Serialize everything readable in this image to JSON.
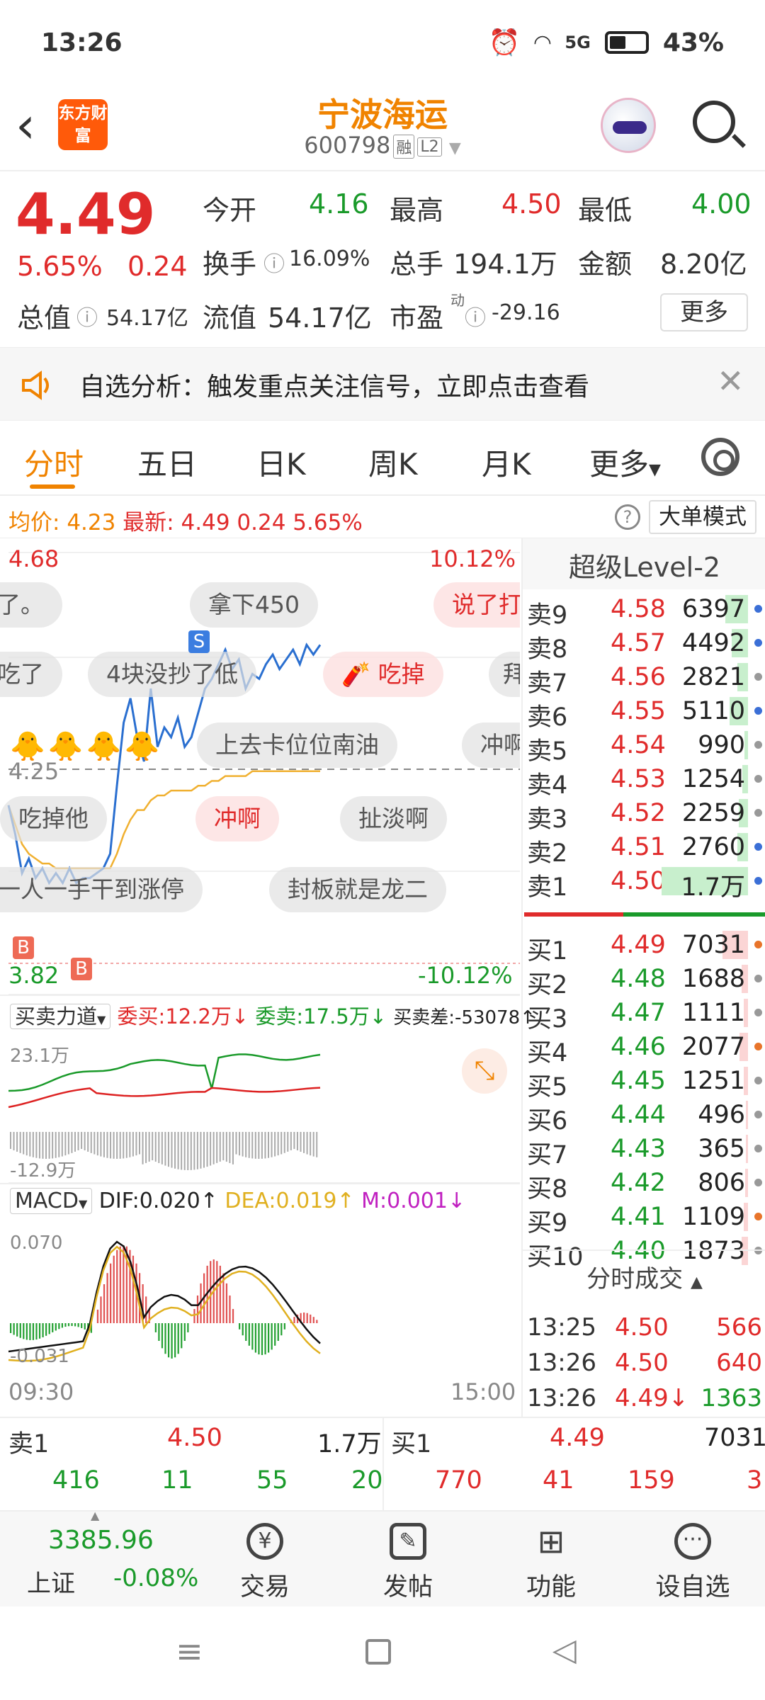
{
  "status_bar": {
    "time": "13:26",
    "battery": "43%",
    "network": "5G"
  },
  "header": {
    "logo_text": "东方财富",
    "stock_name": "宁波海运",
    "stock_code": "600798",
    "tag_margin": "融",
    "tag_level": "L2"
  },
  "quote": {
    "price": "4.49",
    "change_pct": "5.65%",
    "change": "0.24",
    "open_label": "今开",
    "open": "4.16",
    "high_label": "最高",
    "high": "4.50",
    "low_label": "最低",
    "low": "4.00",
    "turnover_label": "换手",
    "turnover": "16.09%",
    "volume_label": "总手",
    "volume": "194.1万",
    "amount_label": "金额",
    "amount": "8.20亿",
    "mktcap_label": "总值",
    "mktcap": "54.17亿",
    "float_label": "流值",
    "float_cap": "54.17亿",
    "pe_label": "市盈",
    "pe_sup": "动",
    "pe": "-29.16",
    "more_button": "更多"
  },
  "banner": {
    "text": "自选分析：触发重点关注信号，立即点击查看"
  },
  "tabs": [
    "分时",
    "五日",
    "日K",
    "周K",
    "月K",
    "更多"
  ],
  "avg_bar": {
    "avg_label": "均价:",
    "avg": "4.23",
    "latest_label": "最新:",
    "latest": "4.49",
    "chg": "0.24",
    "pct": "5.65%",
    "mode_button": "大单模式"
  },
  "chart": {
    "y_top": "4.68",
    "y_top_pct": "10.12%",
    "y_mid": "4.25",
    "y_bottom": "3.82",
    "y_bottom_pct": "-10.12%",
    "time_start": "09:30",
    "time_end": "15:00",
    "marker_s": "S",
    "marker_b": "B",
    "bubbles": [
      "了。",
      "拿下450",
      "说了打",
      "吃了",
      "4块没抄了低",
      "吃掉",
      "拜",
      "上去卡位位南油",
      "冲啊",
      "吃掉他",
      "冲啊",
      "扯淡啊",
      "一人一手干到涨停",
      "封板就是龙二"
    ],
    "flow_selector": "买卖力道",
    "flow_buy": "委买:12.2万↓",
    "flow_sell": "委卖:17.5万↓",
    "flow_diff": "买卖差:-53078↑",
    "flow_max": "23.1万",
    "flow_min": "-12.9万",
    "macd_selector": "MACD",
    "dif": "DIF:0.020↑",
    "dea": "DEA:0.019↑",
    "m": "M:0.001↓",
    "macd_max": "0.070",
    "macd_min": "-0.031",
    "price_series": [
      4.16,
      4.1,
      4.02,
      4.05,
      4.01,
      4.03,
      4.0,
      4.02,
      4.0,
      4.03,
      4.0,
      4.01,
      4.01,
      4.02,
      4.03,
      4.06,
      4.2,
      4.33,
      4.38,
      4.3,
      4.25,
      4.4,
      4.28,
      4.32,
      4.3,
      4.34,
      4.28,
      4.3,
      4.35,
      4.4,
      4.42,
      4.45,
      4.48,
      4.44,
      4.46,
      4.4,
      4.43,
      4.42,
      4.45,
      4.47,
      4.44,
      4.46,
      4.48,
      4.45,
      4.49,
      4.47,
      4.49
    ],
    "avg_series": [
      4.16,
      4.12,
      4.08,
      4.06,
      4.05,
      4.04,
      4.04,
      4.03,
      4.03,
      4.03,
      4.03,
      4.03,
      4.03,
      4.03,
      4.03,
      4.03,
      4.06,
      4.1,
      4.13,
      4.15,
      4.15,
      4.17,
      4.18,
      4.18,
      4.19,
      4.19,
      4.19,
      4.19,
      4.2,
      4.2,
      4.21,
      4.21,
      4.22,
      4.22,
      4.22,
      4.22,
      4.23,
      4.23,
      4.23,
      4.23,
      4.23,
      4.23,
      4.23,
      4.23,
      4.23,
      4.23,
      4.23
    ]
  },
  "orderbook": {
    "title": "超级Level-2",
    "asks": [
      {
        "label": "卖9",
        "price": "4.58",
        "vol": "6397",
        "bar": 0.25,
        "dot": "#3b6fd6"
      },
      {
        "label": "卖8",
        "price": "4.57",
        "vol": "4492",
        "bar": 0.18,
        "dot": "#3b6fd6"
      },
      {
        "label": "卖7",
        "price": "4.56",
        "vol": "2821",
        "bar": 0.12,
        "dot": "#999999"
      },
      {
        "label": "卖6",
        "price": "4.55",
        "vol": "5110",
        "bar": 0.2,
        "dot": "#3b6fd6"
      },
      {
        "label": "卖5",
        "price": "4.54",
        "vol": "990",
        "bar": 0.04,
        "dot": "#999999"
      },
      {
        "label": "卖4",
        "price": "4.53",
        "vol": "1254",
        "bar": 0.06,
        "dot": "#999999"
      },
      {
        "label": "卖3",
        "price": "4.52",
        "vol": "2259",
        "bar": 0.1,
        "dot": "#999999"
      },
      {
        "label": "卖2",
        "price": "4.51",
        "vol": "2760",
        "bar": 0.12,
        "dot": "#3b6fd6"
      },
      {
        "label": "卖1",
        "price": "4.50",
        "vol": "1.7万",
        "bar": 0.95,
        "dot": "#3b6fd6"
      }
    ],
    "bids": [
      {
        "label": "买1",
        "price": "4.49",
        "vol": "7031",
        "bar": 0.28,
        "dot": "#e8742a"
      },
      {
        "label": "买2",
        "price": "4.48",
        "vol": "1688",
        "bar": 0.07,
        "dot": "#999999"
      },
      {
        "label": "买3",
        "price": "4.47",
        "vol": "1111",
        "bar": 0.05,
        "dot": "#999999"
      },
      {
        "label": "买4",
        "price": "4.46",
        "vol": "2077",
        "bar": 0.09,
        "dot": "#e8742a"
      },
      {
        "label": "买5",
        "price": "4.45",
        "vol": "1251",
        "bar": 0.05,
        "dot": "#999999"
      },
      {
        "label": "买6",
        "price": "4.44",
        "vol": "496",
        "bar": 0.02,
        "dot": "#999999"
      },
      {
        "label": "买7",
        "price": "4.43",
        "vol": "365",
        "bar": 0.02,
        "dot": "#999999"
      },
      {
        "label": "买8",
        "price": "4.42",
        "vol": "806",
        "bar": 0.03,
        "dot": "#999999"
      },
      {
        "label": "买9",
        "price": "4.41",
        "vol": "1109",
        "bar": 0.05,
        "dot": "#e8742a"
      },
      {
        "label": "买10",
        "price": "4.40",
        "vol": "1873",
        "bar": 0.07,
        "dot": "#999999"
      }
    ],
    "ticks_title": "分时成交",
    "ticks": [
      {
        "time": "13:25",
        "price": "4.50",
        "vol": "566"
      },
      {
        "time": "13:26",
        "price": "4.50",
        "vol": "640"
      },
      {
        "time": "13:26",
        "price": "4.49↓",
        "vol": "1363"
      }
    ]
  },
  "summary": {
    "ask_label": "卖1",
    "ask_price": "4.50",
    "ask_vol": "1.7万",
    "bid_label": "买1",
    "bid_price": "4.49",
    "bid_vol": "7031",
    "ask_breakdown": [
      "416",
      "11",
      "55",
      "20"
    ],
    "bid_breakdown": [
      "770",
      "41",
      "159",
      "3"
    ]
  },
  "bottom_nav": {
    "index_value": "3385.96",
    "index_name": "上证",
    "index_pct": "-0.08%",
    "items": [
      "交易",
      "发帖",
      "功能",
      "设自选"
    ]
  }
}
